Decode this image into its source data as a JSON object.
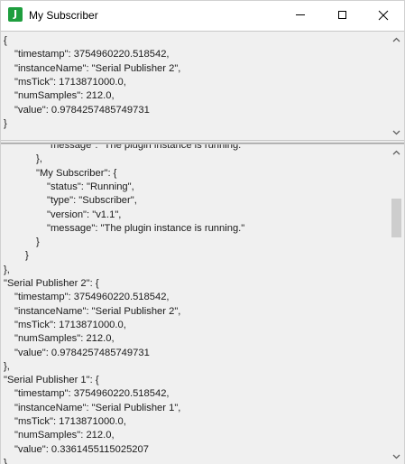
{
  "window": {
    "title": "My Subscriber",
    "app_icon_letter": "J",
    "app_icon_color": "#1e9e3e"
  },
  "top_pane": {
    "lines": [
      {
        "indent": 0,
        "text": "{"
      },
      {
        "indent": 1,
        "text": "\"timestamp\": 3754960220.518542,"
      },
      {
        "indent": 1,
        "text": "\"instanceName\": \"Serial Publisher 2\","
      },
      {
        "indent": 1,
        "text": "\"msTick\": 1713871000.0,"
      },
      {
        "indent": 1,
        "text": "\"numSamples\": 212.0,"
      },
      {
        "indent": 1,
        "text": "\"value\": 0.9784257485749731"
      },
      {
        "indent": 0,
        "text": "}"
      }
    ]
  },
  "bottom_pane": {
    "lines": [
      {
        "indent": 4,
        "text": "\"message\": \"The plugin instance is running.\""
      },
      {
        "indent": 3,
        "text": "},"
      },
      {
        "indent": 3,
        "text": "\"My Subscriber\": {"
      },
      {
        "indent": 4,
        "text": "\"status\": \"Running\","
      },
      {
        "indent": 4,
        "text": "\"type\": \"Subscriber\","
      },
      {
        "indent": 4,
        "text": "\"version\": \"v1.1\","
      },
      {
        "indent": 4,
        "text": "\"message\": \"The plugin instance is running.\""
      },
      {
        "indent": 3,
        "text": "}"
      },
      {
        "indent": 2,
        "text": "}"
      },
      {
        "indent": 0,
        "text": "},"
      },
      {
        "indent": 0,
        "text": "\"Serial Publisher 2\": {"
      },
      {
        "indent": 1,
        "text": "\"timestamp\": 3754960220.518542,"
      },
      {
        "indent": 1,
        "text": "\"instanceName\": \"Serial Publisher 2\","
      },
      {
        "indent": 1,
        "text": "\"msTick\": 1713871000.0,"
      },
      {
        "indent": 1,
        "text": "\"numSamples\": 212.0,"
      },
      {
        "indent": 1,
        "text": "\"value\": 0.9784257485749731"
      },
      {
        "indent": 0,
        "text": "},"
      },
      {
        "indent": 0,
        "text": "\"Serial Publisher 1\": {"
      },
      {
        "indent": 1,
        "text": "\"timestamp\": 3754960220.518542,"
      },
      {
        "indent": 1,
        "text": "\"instanceName\": \"Serial Publisher 1\","
      },
      {
        "indent": 1,
        "text": "\"msTick\": 1713871000.0,"
      },
      {
        "indent": 1,
        "text": "\"numSamples\": 212.0,"
      },
      {
        "indent": 1,
        "text": "\"value\": 0.3361455115025207"
      },
      {
        "indent": 0,
        "text": "},"
      }
    ]
  }
}
